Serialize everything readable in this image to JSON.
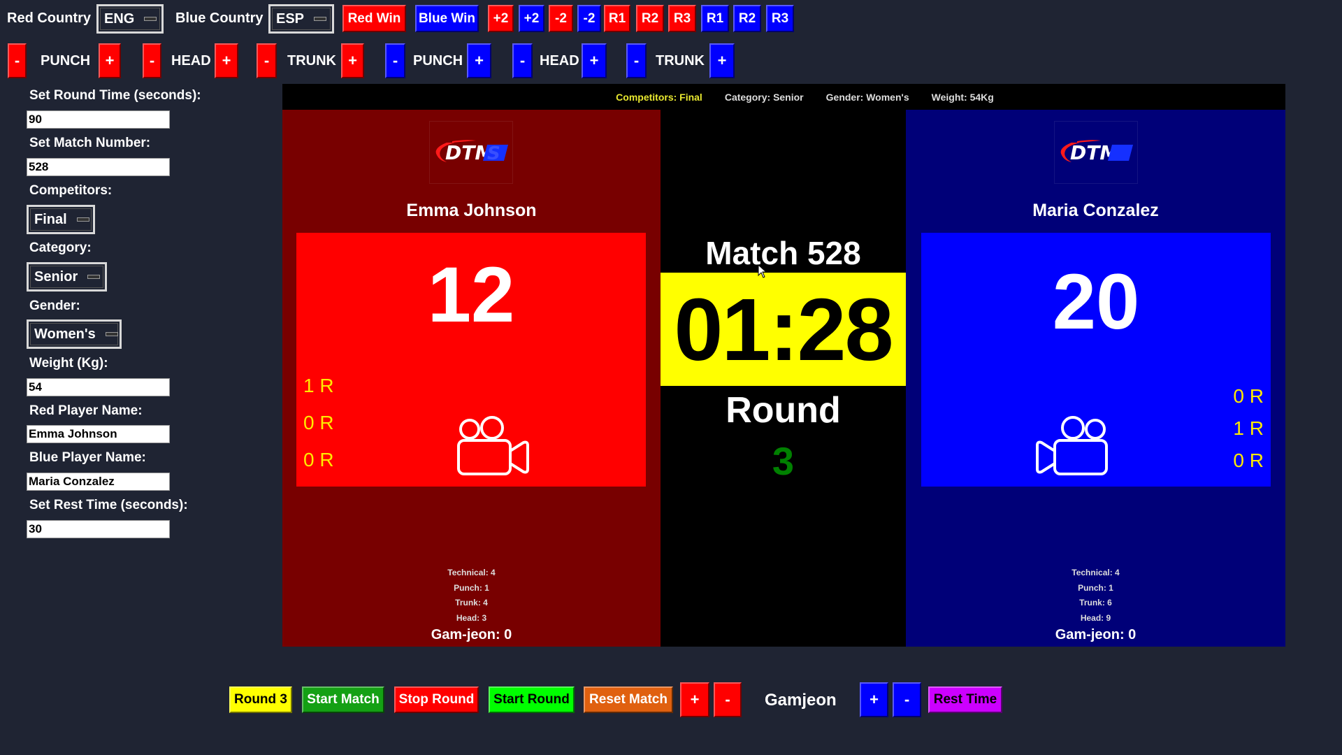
{
  "top_row": {
    "red_country_label": "Red Country",
    "red_country_value": "ENG",
    "blue_country_label": "Blue Country",
    "blue_country_value": "ESP",
    "red_win": "Red Win",
    "blue_win": "Blue Win",
    "red_plus2": "+2",
    "blue_plus2": "+2",
    "red_minus2": "-2",
    "blue_minus2": "-2",
    "red_r1": "R1",
    "red_r2": "R2",
    "red_r3": "R3",
    "blue_r1": "R1",
    "blue_r2": "R2",
    "blue_r3": "R3"
  },
  "scoring_row": {
    "minus": "-",
    "plus": "+",
    "punch": "PUNCH",
    "head": "HEAD",
    "trunk": "TRUNK"
  },
  "sidebar": {
    "round_time_label": "Set Round Time (seconds):",
    "round_time_value": "90",
    "match_number_label": "Set Match Number:",
    "match_number_value": "528",
    "competitors_label": "Competitors:",
    "competitors_value": "Final",
    "category_label": "Category:",
    "category_value": "Senior",
    "gender_label": "Gender:",
    "gender_value": "Women's",
    "weight_label": "Weight (Kg):",
    "weight_value": "54",
    "red_name_label": "Red Player Name:",
    "red_name_value": "Emma Johnson",
    "blue_name_label": "Blue Player Name:",
    "blue_name_value": "Maria Conzalez",
    "rest_time_label": "Set Rest Time (seconds):",
    "rest_time_value": "30"
  },
  "scoreboard": {
    "info": {
      "competitors": "Competitors: Final",
      "category": "Category: Senior",
      "gender": "Gender: Women's",
      "weight": "Weight: 54Kg"
    },
    "logo_text": "DTMS",
    "red": {
      "name": "Emma Johnson",
      "score": "12",
      "rounds": [
        "1 R",
        "0 R",
        "0 R"
      ],
      "technical": "Technical: 4",
      "punch": "Punch: 1",
      "trunk": "Trunk: 4",
      "head": "Head: 3",
      "gamjeon": "Gam-jeon: 0"
    },
    "blue": {
      "name": "Maria Conzalez",
      "score": "20",
      "rounds": [
        "0 R",
        "1 R",
        "0 R"
      ],
      "technical": "Technical: 4",
      "punch": "Punch: 1",
      "trunk": "Trunk: 6",
      "head": "Head: 9",
      "gamjeon": "Gam-jeon: 0"
    },
    "match_title": "Match 528",
    "timer": "01:28",
    "round_label": "Round",
    "round_number": "3"
  },
  "bottom_bar": {
    "round_button": "Round 3",
    "start_match": "Start Match",
    "stop_round": "Stop Round",
    "start_round": "Start Round",
    "reset_match": "Reset Match",
    "red_plus": "+",
    "red_minus": "-",
    "gamjeon_label": "Gamjeon",
    "blue_plus": "+",
    "blue_minus": "-",
    "rest_time": "Rest Time"
  },
  "colors": {
    "background": "#1f2433",
    "red_accent": "#ff0000",
    "blue_accent": "#0000ff",
    "red_panel": "#780000",
    "blue_panel": "#000078",
    "timer_bg": "#ffff00",
    "round_number": "#008000",
    "round_indicator": "#ffea00"
  }
}
